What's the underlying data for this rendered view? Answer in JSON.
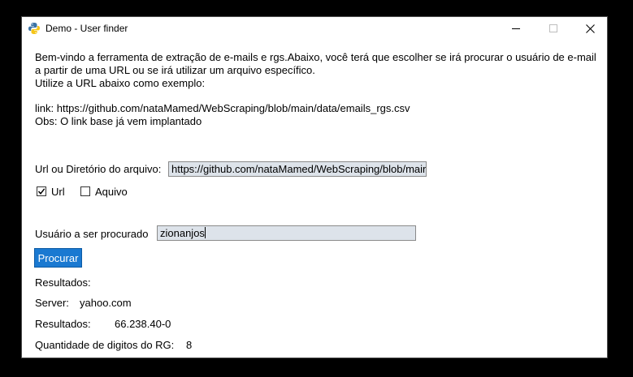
{
  "window": {
    "title": "Demo - User finder",
    "controls": {
      "minimize": "minimize",
      "maximize": "maximize",
      "close": "close"
    }
  },
  "intro": {
    "line1": "Bem-vindo a ferramenta de extração de e-mails e rgs.Abaixo, você terá que escolher se irá procurar o usuário de e-mail",
    "line2": "a partir de uma URL ou se irá utilizar um arquivo específico.",
    "line3": "Utilize a URL abaixo como exemplo:",
    "link_line": "link: https://github.com/nataMamed/WebScraping/blob/main/data/emails_rgs.csv",
    "obs_line": "Obs: O link base já vem implantado"
  },
  "source": {
    "label": "Url ou Diretório do arquivo:",
    "value": "https://github.com/nataMamed/WebScraping/blob/main",
    "options": [
      {
        "label": "Url",
        "checked": true
      },
      {
        "label": "Aquivo",
        "checked": false
      }
    ]
  },
  "search": {
    "label": "Usuário a ser procurado",
    "value": "zionanjos",
    "button": "Procurar"
  },
  "results": {
    "heading": "Resultados:",
    "server_label": "Server:",
    "server_value": "yahoo.com",
    "results_label": "Resultados:",
    "results_value": "66.238.40-0",
    "rg_digits_label": "Quantidade de digitos do RG:",
    "rg_digits_value": "8"
  },
  "colors": {
    "button_bg": "#1a79d1",
    "input_bg": "#dde3ea"
  }
}
